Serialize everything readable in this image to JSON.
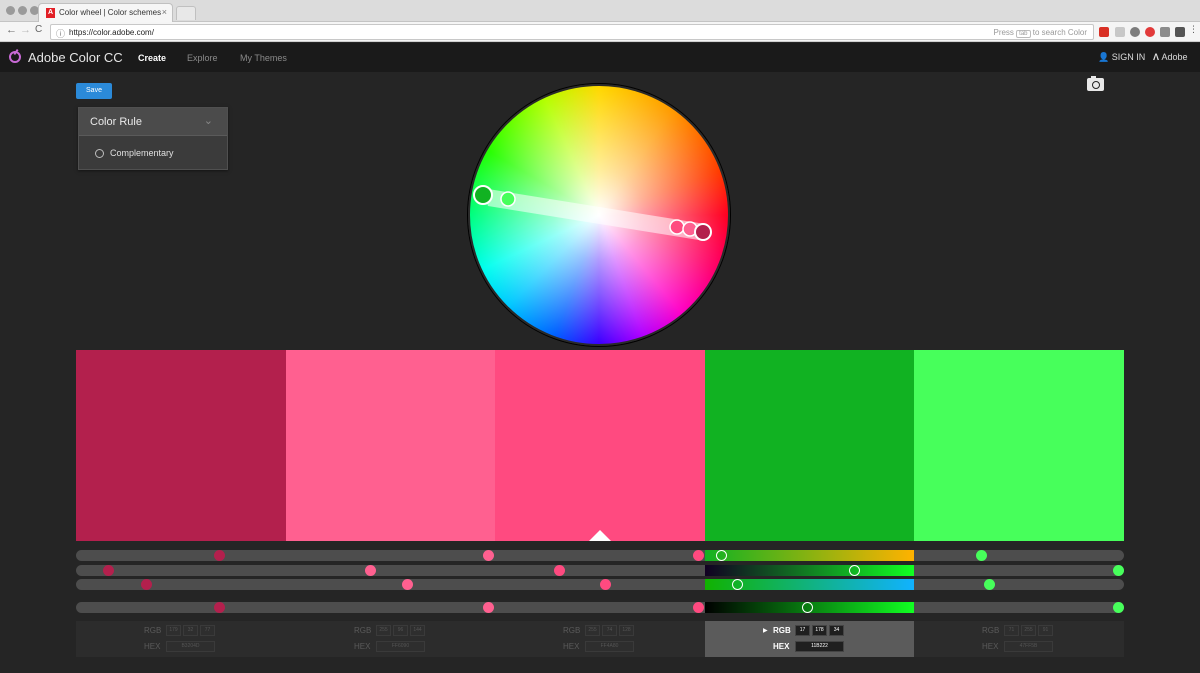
{
  "browser": {
    "tab_title": "Color wheel | Color schemes",
    "tab_close": "×",
    "back": "←",
    "forward": "→",
    "reload": "C",
    "url": "https://color.adobe.com/",
    "search_hint_prefix": "Press",
    "search_hint_key": "tab",
    "search_hint_suffix": "to search Color"
  },
  "app": {
    "brand": "Adobe Color CC",
    "nav": [
      "Create",
      "Explore",
      "My Themes"
    ],
    "signin": "SIGN IN",
    "adobe": "Adobe",
    "save": "Save"
  },
  "color_rule": {
    "title": "Color Rule",
    "selected": "Complementary"
  },
  "swatches": [
    {
      "hex": "B3204D",
      "rgb": [
        "179",
        "32",
        "77"
      ],
      "color": "#b3204d"
    },
    {
      "hex": "FF6090",
      "rgb": [
        "255",
        "96",
        "144"
      ],
      "color": "#ff6090"
    },
    {
      "hex": "FF4A80",
      "rgb": [
        "255",
        "74",
        "128"
      ],
      "color": "#ff4a80"
    },
    {
      "hex": "11B222",
      "rgb": [
        "17",
        "178",
        "34"
      ],
      "color": "#11b222"
    },
    {
      "hex": "47FF5B",
      "rgb": [
        "71",
        "255",
        "91"
      ],
      "color": "#47ff5b"
    }
  ],
  "selected_swatch": 3,
  "sliders": {
    "r": [
      0.137,
      0.394,
      0.594,
      0.616,
      0.864
    ],
    "g": [
      0.031,
      0.281,
      0.461,
      0.743,
      1.0
    ],
    "b": [
      0.067,
      0.316,
      0.505,
      0.631,
      0.872
    ],
    "brightness": [
      0.137,
      0.394,
      0.594,
      0.698,
      1.0
    ]
  },
  "labels": {
    "rgb": "RGB",
    "hex": "HEX"
  }
}
